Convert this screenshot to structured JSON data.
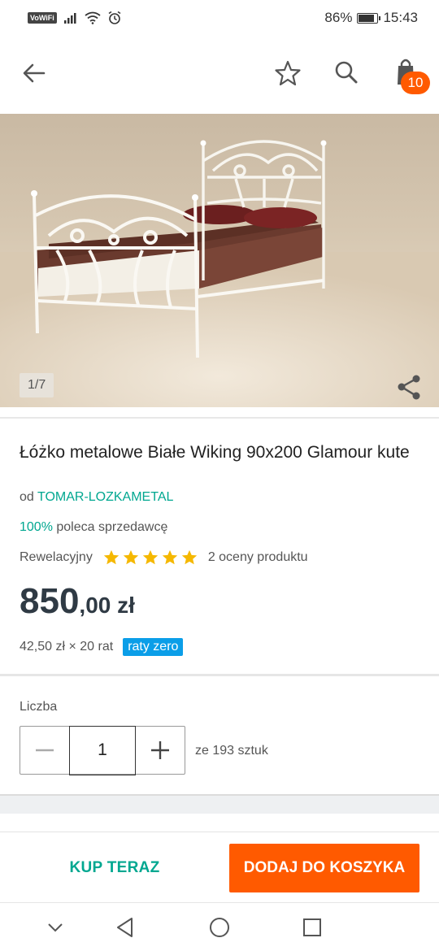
{
  "status_bar": {
    "vowifi": "VoWiFi",
    "battery": "86%",
    "battery_level": 0.86,
    "time": "15:43"
  },
  "app_bar": {
    "cart_count": "10",
    "icons": [
      "back-arrow-icon",
      "star-icon",
      "search-icon",
      "shopping-bag-icon"
    ]
  },
  "gallery": {
    "counter": "1/7"
  },
  "product": {
    "title": "Łóżko metalowe Białe Wiking 90x200 Glamour kute",
    "seller_prefix": "od",
    "seller_name": "TOMAR-LOZKAMETAL",
    "recommend_pct": "100%",
    "recommend_text": "poleca sprzedawcę",
    "rating_label": "Rewelacyjny",
    "rating_stars": 5,
    "rating_count": "2 oceny produktu",
    "price_int": "850",
    "price_dec": ",00 zł",
    "installment": "42,50 zł × 20 rat",
    "installment_badge": "raty zero"
  },
  "quantity": {
    "label": "Liczba",
    "value": "1",
    "stock": "ze 193 sztuk"
  },
  "actions": {
    "buy_now": "KUP TERAZ",
    "add_to_cart": "DODAJ DO KOSZYKA"
  },
  "colors": {
    "accent": "#00a790",
    "cta": "#ff5a00",
    "price": "#2f3a44",
    "badge_blue": "#0b9ee8",
    "star": "#f5b800"
  }
}
